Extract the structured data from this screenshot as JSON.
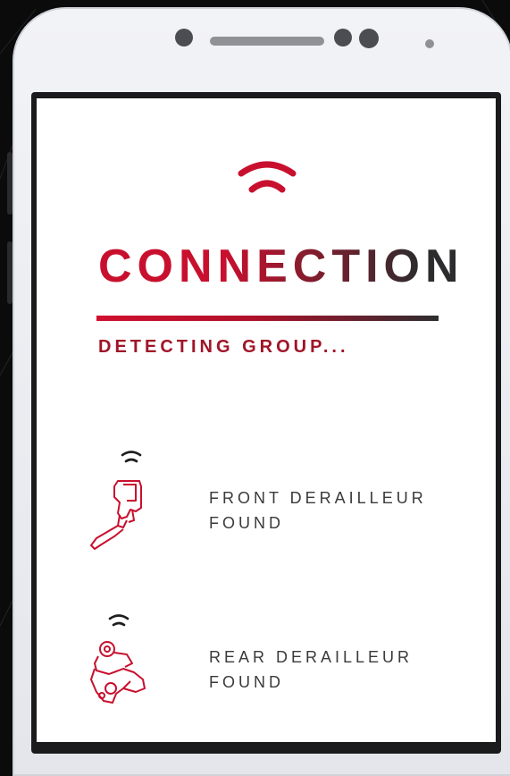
{
  "screen": {
    "title": "CONNECTION",
    "status": "DETECTING GROUP...",
    "devices": [
      {
        "line1": "FRONT DERAILLEUR",
        "line2": "FOUND",
        "icon": "front-derailleur-icon"
      },
      {
        "line1": "REAR DERAILLEUR",
        "line2": "FOUND",
        "icon": "rear-derailleur-icon"
      }
    ]
  },
  "colors": {
    "accent": "#c8102e",
    "dark": "#2c2c2e",
    "text": "#3a3a3c",
    "background": "#0b0b0c"
  }
}
